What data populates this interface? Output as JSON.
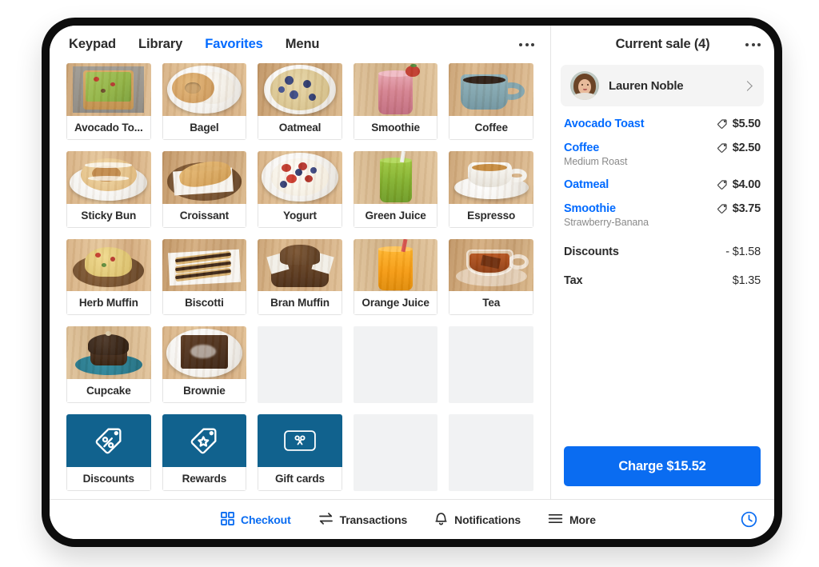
{
  "app": {
    "tabs": [
      {
        "label": "Keypad",
        "active": false
      },
      {
        "label": "Library",
        "active": false
      },
      {
        "label": "Favorites",
        "active": true
      },
      {
        "label": "Menu",
        "active": false
      }
    ],
    "overflow_icon": "kebab-menu-icon",
    "accent_blue": "#006aff",
    "charge_blue": "#0a6cf1",
    "action_tile_color": "#11628e"
  },
  "grid": {
    "rows": 5,
    "columns": 5,
    "items": [
      {
        "label": "Avocado To...",
        "full_name": "Avocado Toast",
        "type": "product",
        "art": "avocado-toast"
      },
      {
        "label": "Bagel",
        "type": "product",
        "art": "bagel"
      },
      {
        "label": "Oatmeal",
        "type": "product",
        "art": "oatmeal"
      },
      {
        "label": "Smoothie",
        "type": "product",
        "art": "smoothie"
      },
      {
        "label": "Coffee",
        "type": "product",
        "art": "coffee"
      },
      {
        "label": "Sticky Bun",
        "type": "product",
        "art": "sticky-bun"
      },
      {
        "label": "Croissant",
        "type": "product",
        "art": "croissant"
      },
      {
        "label": "Yogurt",
        "type": "product",
        "art": "yogurt"
      },
      {
        "label": "Green Juice",
        "type": "product",
        "art": "green-juice"
      },
      {
        "label": "Espresso",
        "type": "product",
        "art": "espresso"
      },
      {
        "label": "Herb Muffin",
        "type": "product",
        "art": "herb-muffin"
      },
      {
        "label": "Biscotti",
        "type": "product",
        "art": "biscotti"
      },
      {
        "label": "Bran Muffin",
        "type": "product",
        "art": "bran-muffin"
      },
      {
        "label": "Orange Juice",
        "type": "product",
        "art": "orange-juice"
      },
      {
        "label": "Tea",
        "type": "product",
        "art": "tea"
      },
      {
        "label": "Cupcake",
        "type": "product",
        "art": "cupcake"
      },
      {
        "label": "Brownie",
        "type": "product",
        "art": "brownie"
      },
      {
        "label": "",
        "type": "empty"
      },
      {
        "label": "",
        "type": "empty"
      },
      {
        "label": "",
        "type": "empty"
      },
      {
        "label": "Discounts",
        "type": "action",
        "art": "discount-tag-icon"
      },
      {
        "label": "Rewards",
        "type": "action",
        "art": "rewards-star-tag-icon"
      },
      {
        "label": "Gift cards",
        "type": "action",
        "art": "gift-card-icon"
      },
      {
        "label": "",
        "type": "empty"
      },
      {
        "label": "",
        "type": "empty"
      }
    ]
  },
  "sale": {
    "title": "Current sale (4)",
    "overflow_icon": "kebab-menu-icon",
    "customer": {
      "name": "Lauren Noble",
      "avatar": "customer-photo",
      "chevron": "chevron-right-icon"
    },
    "line_items": [
      {
        "name": "Avocado Toast",
        "modifier": "",
        "price": "$5.50",
        "discounted": true
      },
      {
        "name": "Coffee",
        "modifier": "Medium Roast",
        "price": "$2.50",
        "discounted": true
      },
      {
        "name": "Oatmeal",
        "modifier": "",
        "price": "$4.00",
        "discounted": true
      },
      {
        "name": "Smoothie",
        "modifier": "Strawberry-Banana",
        "price": "$3.75",
        "discounted": true
      }
    ],
    "summary": [
      {
        "label": "Discounts",
        "value": "- $1.58"
      },
      {
        "label": "Tax",
        "value": "$1.35"
      }
    ],
    "charge_label": "Charge $15.52"
  },
  "bottom_nav": {
    "items": [
      {
        "label": "Checkout",
        "icon": "grid-squares-icon",
        "active": true
      },
      {
        "label": "Transactions",
        "icon": "transfer-arrows-icon",
        "active": false
      },
      {
        "label": "Notifications",
        "icon": "bell-icon",
        "active": false
      },
      {
        "label": "More",
        "icon": "hamburger-icon",
        "active": false
      }
    ],
    "clock_icon": "clock-icon"
  }
}
